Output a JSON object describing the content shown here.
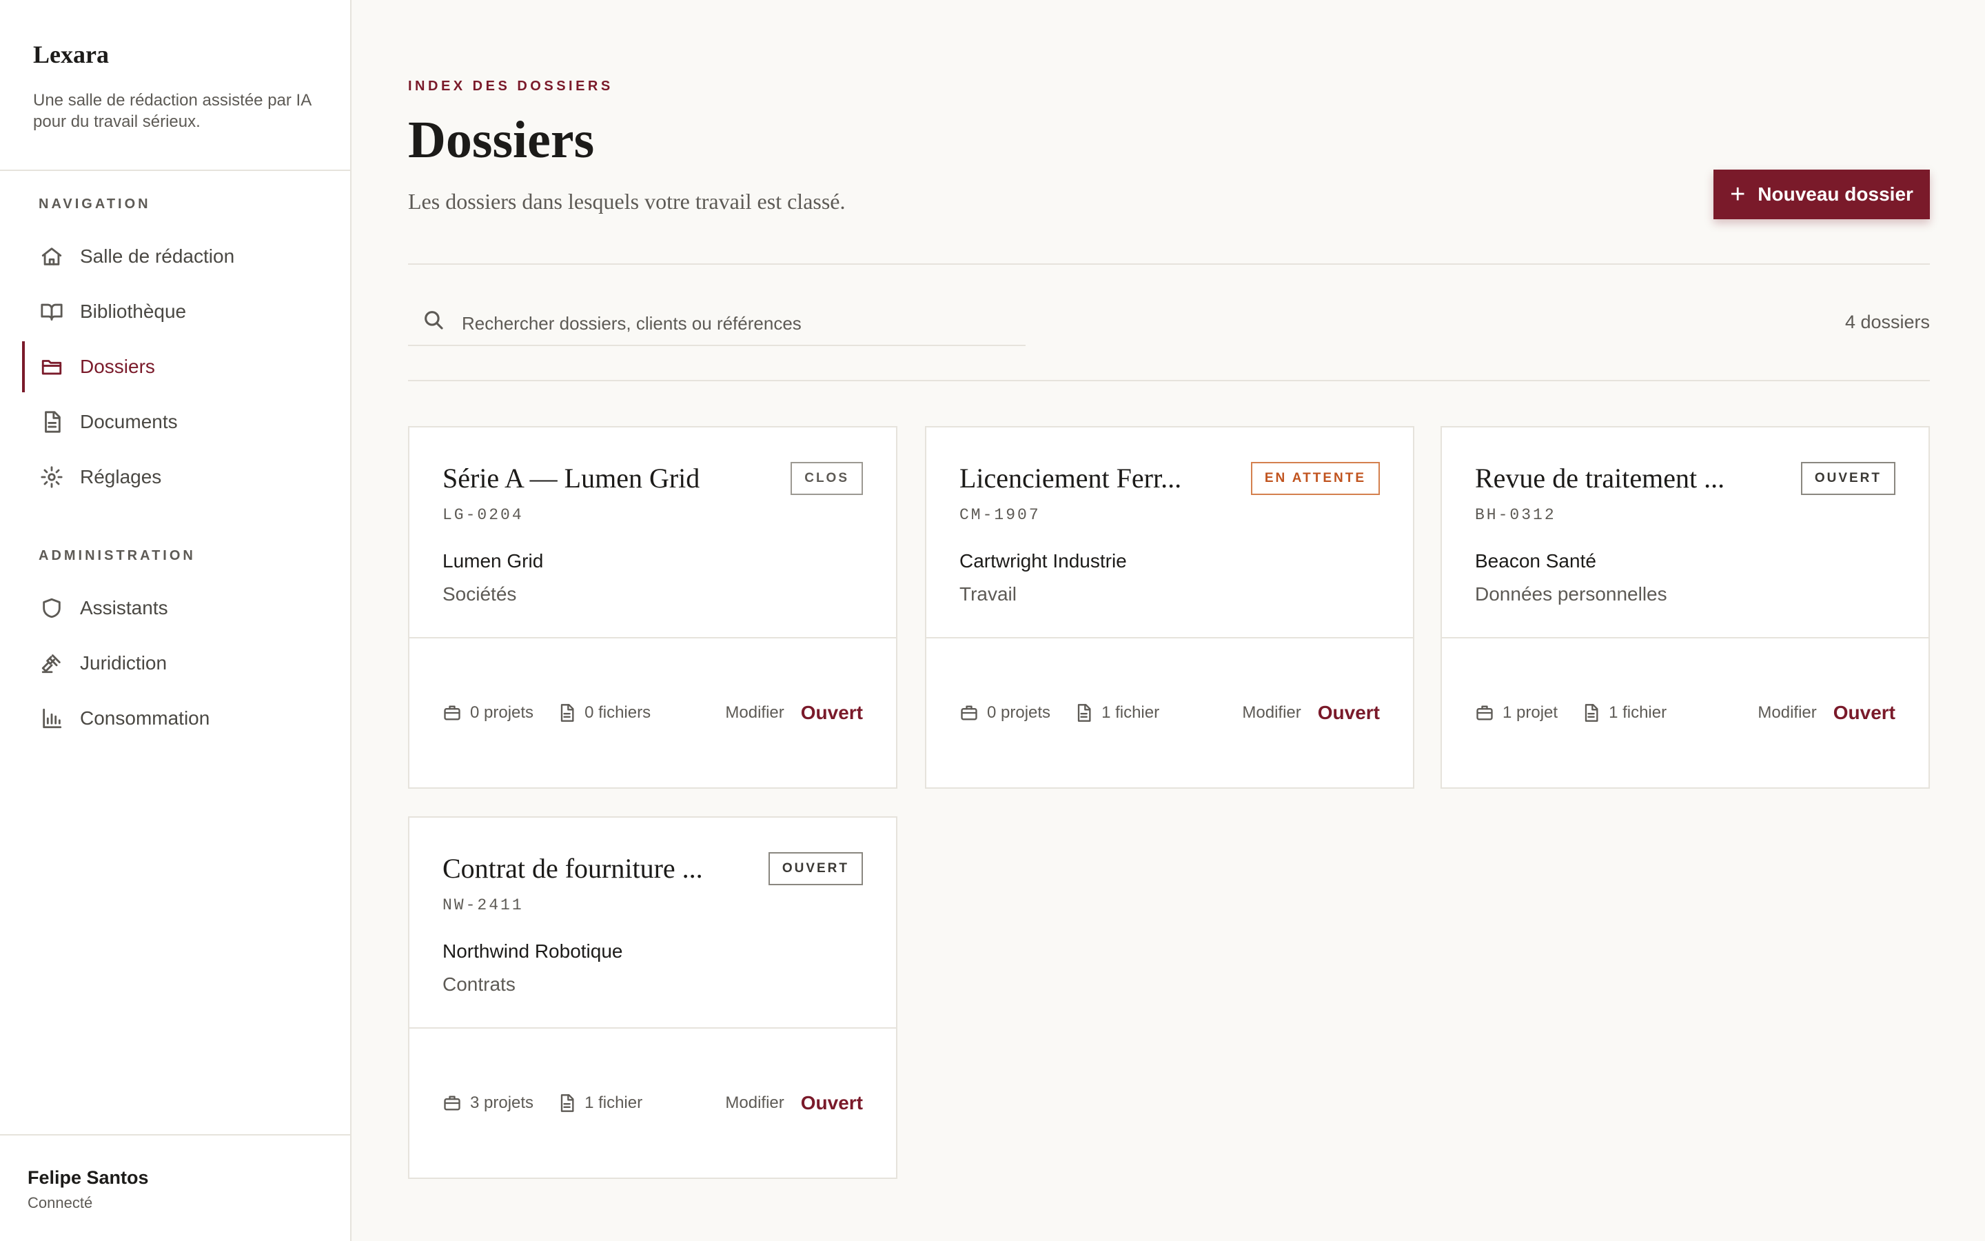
{
  "brand": {
    "name": "Lexara",
    "tagline": "Une salle de rédaction assistée par IA pour du travail sérieux."
  },
  "sidebar": {
    "section_navigation": "NAVIGATION",
    "section_admin": "ADMINISTRATION",
    "nav_items": [
      {
        "label": "Salle de rédaction",
        "icon": "home-icon"
      },
      {
        "label": "Bibliothèque",
        "icon": "book-icon"
      },
      {
        "label": "Dossiers",
        "icon": "folder-icon",
        "active": true
      },
      {
        "label": "Documents",
        "icon": "document-icon"
      },
      {
        "label": "Réglages",
        "icon": "gear-icon"
      }
    ],
    "admin_items": [
      {
        "label": "Assistants",
        "icon": "shield-icon"
      },
      {
        "label": "Juridiction",
        "icon": "gavel-icon"
      },
      {
        "label": "Consommation",
        "icon": "bar-chart-icon"
      }
    ]
  },
  "user": {
    "name": "Felipe Santos",
    "status": "Connecté"
  },
  "header": {
    "eyebrow": "INDEX DES DOSSIERS",
    "title": "Dossiers",
    "subtitle": "Les dossiers dans lesquels votre travail est classé.",
    "new_button": "Nouveau dossier"
  },
  "search": {
    "placeholder": "Rechercher dossiers, clients ou références",
    "value": "",
    "count_label": "4 dossiers"
  },
  "cards": [
    {
      "title": "Série A — Lumen Grid",
      "badge": "CLOS",
      "ref": "LG-0204",
      "client": "Lumen Grid",
      "area": "Sociétés",
      "projects": "0 projets",
      "files": "0 fichiers",
      "edit": "Modifier",
      "open": "Ouvert"
    },
    {
      "title": "Licenciement Ferr...",
      "badge": "EN ATTENTE",
      "ref": "CM-1907",
      "client": "Cartwright Industrie",
      "area": "Travail",
      "projects": "0 projets",
      "files": "1 fichier",
      "edit": "Modifier",
      "open": "Ouvert"
    },
    {
      "title": "Revue de traitement ...",
      "badge": "OUVERT",
      "ref": "BH-0312",
      "client": "Beacon Santé",
      "area": "Données personnelles",
      "projects": "1 projet",
      "files": "1 fichier",
      "edit": "Modifier",
      "open": "Ouvert"
    },
    {
      "title": "Contrat de fourniture ...",
      "badge": "OUVERT",
      "ref": "NW-2411",
      "client": "Northwind Robotique",
      "area": "Contrats",
      "projects": "3 projets",
      "files": "1 fichier",
      "edit": "Modifier",
      "open": "Ouvert"
    }
  ],
  "colors": {
    "accent": "#7a1a2a",
    "background": "#faf9f6",
    "pending": "#c0531e",
    "border": "#e6e3dc"
  }
}
